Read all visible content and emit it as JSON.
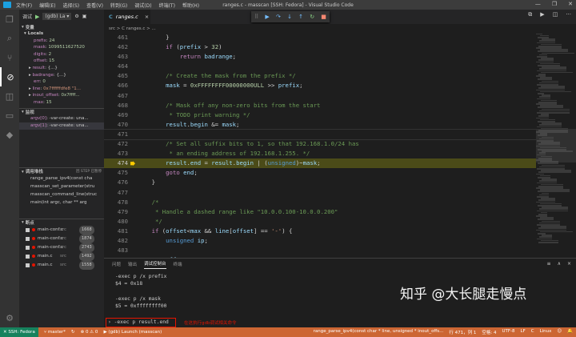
{
  "window": {
    "title": "ranges.c - masscan [SSH: Fedora] - Visual Studio Code",
    "menus": [
      "文件(F)",
      "编辑(E)",
      "选择(S)",
      "查看(V)",
      "转到(G)",
      "调试(D)",
      "终端(T)",
      "帮助(H)"
    ],
    "controls": [
      "—",
      "❐",
      "✕"
    ]
  },
  "activity_icons": [
    "files-icon",
    "search-icon",
    "source-control-icon",
    "debug-icon",
    "extensions-icon",
    "remote-explorer-icon",
    "docker-icon"
  ],
  "sidebar": {
    "debug_label": "调试",
    "config": "(gdb) La ▾",
    "variables_header": "变量",
    "locals_header": "Locals",
    "locals": [
      {
        "name": "prefix",
        "value": "24"
      },
      {
        "name": "mask",
        "value": "1099511627520"
      },
      {
        "name": "digits",
        "value": "2"
      },
      {
        "name": "offset",
        "value": "15"
      },
      {
        "name": "result",
        "value": "{...}",
        "expandable": true
      },
      {
        "name": "badrange",
        "value": "{...}",
        "expandable": true
      },
      {
        "name": "err",
        "value": "0"
      },
      {
        "name": "line",
        "value": "0x7ffffffdfe8 \"1...",
        "expandable": true
      },
      {
        "name": "inout_offset",
        "value": "0x7ffff...",
        "expandable": true
      },
      {
        "name": "max",
        "value": "15"
      }
    ],
    "watch_header": "监视",
    "watch": [
      {
        "name": "argv[0]",
        "value": "-var-create: una..."
      },
      {
        "name": "argv[1]",
        "value": "-var-create: una..."
      }
    ],
    "callstack_header": "调用堆栈",
    "callstack_badge": "因 STEP 已暂停",
    "callstack": [
      "range_parse_ipv4(const cha",
      "masscan_set_parameter(stru",
      "masscan_command_line(struc",
      "main(int argc, char ** arg"
    ],
    "breakpoints_header": "断点",
    "breakpoints": [
      {
        "file": "main-conf.c",
        "dir": "src",
        "line": "1668"
      },
      {
        "file": "main-conf.c",
        "dir": "src",
        "line": "1874"
      },
      {
        "file": "main-conf.c",
        "dir": "src",
        "line": "2743"
      },
      {
        "file": "main.c",
        "dir": "src",
        "line": "1492"
      },
      {
        "file": "main.c",
        "dir": "src",
        "line": "1558"
      }
    ]
  },
  "editor": {
    "tab": {
      "icon": "C",
      "label": "ranges.c",
      "close": "×"
    },
    "breadcrumb": "src > C ranges.c > ...",
    "current_line": "474",
    "lines": [
      {
        "no": "461",
        "html": "        }"
      },
      {
        "no": "462",
        "html": "        <span class=\"ctl\">if</span> (<span class=\"var\">prefix</span> &gt; <span class=\"num\">32</span>)"
      },
      {
        "no": "463",
        "html": "            <span class=\"ctl\">return</span> <span class=\"var\">badrange</span>;"
      },
      {
        "no": "464",
        "html": ""
      },
      {
        "no": "465",
        "html": "        <span class=\"cm\">/* Create the mask from the prefix */</span>"
      },
      {
        "no": "466",
        "html": "        <span class=\"var\">mask</span> = <span class=\"num\">0xFFFFFFFF00000000ULL</span> &gt;&gt; <span class=\"var\">prefix</span>;"
      },
      {
        "no": "467",
        "html": ""
      },
      {
        "no": "468",
        "html": "        <span class=\"cm\">/* Mask off any non-zero bits from the start</span>"
      },
      {
        "no": "469",
        "html": "<span class=\"cm\">         * TODO print warning */</span>"
      },
      {
        "no": "470",
        "html": "        <span class=\"var\">result</span>.<span class=\"var\">begin</span> &amp;= <span class=\"var\">mask</span>;"
      },
      {
        "no": "471",
        "html": ""
      },
      {
        "no": "472",
        "html": "        <span class=\"cm\">/* Set all suffix bits to 1, so that 192.168.1.0/24 has</span>"
      },
      {
        "no": "473",
        "html": "<span class=\"cm\">         * an ending address of 192.168.1.255. */</span>"
      },
      {
        "no": "474",
        "html": "        <span class=\"var\">result</span>.<span class=\"var\">end</span> = <span class=\"var\">result</span>.<span class=\"var\">begin</span> | (<span class=\"typ\">unsigned</span>)~<span class=\"var\">mask</span>;"
      },
      {
        "no": "475",
        "html": "        <span class=\"ctl\">goto</span> <span class=\"var\">end</span>;"
      },
      {
        "no": "476",
        "html": "    }"
      },
      {
        "no": "477",
        "html": ""
      },
      {
        "no": "478",
        "html": "    <span class=\"cm\">/*</span>"
      },
      {
        "no": "479",
        "html": "<span class=\"cm\">     * Handle a dashed range like \"10.0.0.100-10.0.0.200\"</span>"
      },
      {
        "no": "480",
        "html": "<span class=\"cm\">     */</span>"
      },
      {
        "no": "481",
        "html": "    <span class=\"ctl\">if</span> (<span class=\"var\">offset</span>&lt;<span class=\"var\">max</span> &amp;&amp; <span class=\"var\">line</span>[<span class=\"var\">offset</span>] == <span class=\"str\">'-'</span>) {"
      },
      {
        "no": "482",
        "html": "        <span class=\"typ\">unsigned</span> <span class=\"var\">ip</span>;"
      },
      {
        "no": "483",
        "html": ""
      },
      {
        "no": "484",
        "html": "        <span class=\"var\">offset</span>++;"
      }
    ]
  },
  "debug_toolbar": [
    "⠿",
    "▶",
    "↷",
    "↓",
    "↑",
    "↻",
    "■"
  ],
  "editor_actions": [
    "⧉",
    "▶",
    "◫",
    "···"
  ],
  "panel": {
    "tabs": [
      "问题",
      "输出",
      "调试控制台",
      "终端"
    ],
    "active_tab": "调试控制台",
    "output": "-exec p /x prefix\n$4 = 0x18\n\n-exec p /x mask\n$5 = 0xffffffff00",
    "input": "-exec p result.end",
    "note": "在这执行gdb调试相关命令",
    "watermark": "知乎 @大长腿走慢点",
    "actions": [
      "≡",
      "∧",
      "×"
    ]
  },
  "statusbar": {
    "remote": "✕ SSH: Fedora",
    "branch": "master*",
    "sync": "↻",
    "problems": "⊗ 0 ⚠ 0",
    "launch": "(gdb) Launch (masscan)",
    "function": "range_parse_ipv4(const char * line, unsigned * inout_offs...",
    "position": "行 471，列 1",
    "spaces": "空格: 4",
    "encoding": "UTF-8",
    "eol": "LF",
    "language": "C",
    "platform": "Linux"
  },
  "colors": {
    "statusbar": "#cc6633",
    "remote": "#16825d",
    "current_line": "#4b4b18",
    "breakpoint": "#e51400"
  }
}
